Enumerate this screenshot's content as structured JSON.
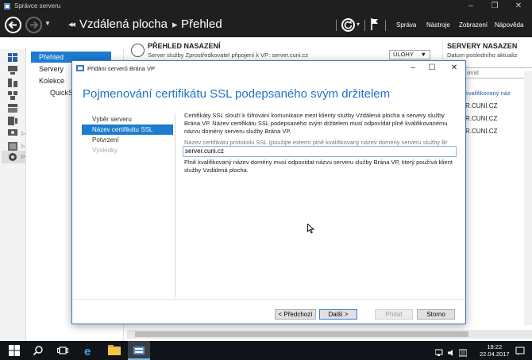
{
  "window": {
    "title": "Správce serveru"
  },
  "header": {
    "breadcrumb_parent": "Vzdálená plocha",
    "breadcrumb_current": "Přehled",
    "menu": [
      "Správa",
      "Nástroje",
      "Zobrazení",
      "Nápověda"
    ]
  },
  "nav": {
    "items": [
      "Přehled",
      "Servery",
      "Kolekce",
      "QuickSe"
    ]
  },
  "background": {
    "deploy_title": "PŘEHLED NASAZENÍ",
    "deploy_sub": "Server služby Zprostředkovatel připojení k VP: server.cuni.cz",
    "tasks_label": "ÚLOHY",
    "servers_title": "SERVERY NASAZEN",
    "servers_sub": "Datum posledního aktualiz",
    "filter_placeholder": "avat",
    "col_header": "kvalifikovaný náz",
    "rows": [
      "R.CUNI.CZ",
      "R.CUNI.CZ",
      "R.CUNI.CZ"
    ]
  },
  "dialog": {
    "title": "Přidání serverů Brána VP",
    "heading": "Pojmenování certifikátu SSL podepsaného svým držitelem",
    "steps": [
      {
        "label": "Výběr serveru",
        "state": "normal"
      },
      {
        "label": "Název certifikátu SSL",
        "state": "selected"
      },
      {
        "label": "Potvrzení",
        "state": "normal"
      },
      {
        "label": "Výsledky",
        "state": "disabled"
      }
    ],
    "description": "Certifikáty SSL slouží k šifrování komunikace mezi klienty služby Vzdálená plocha a servery služby Brána VP. Název certifikátu SSL podepsaného svým držitelem musí odpovídat plně kvalifikovanému názvu domény serveru služby Brána VP.",
    "field_label": "Název certifikátu protokolu SSL (použijte externí plně kvalifikovaný název domény serveru služby Br",
    "field_value": "server.cuni.cz",
    "note": "Plně kvalifikovaný název domény musí odpovídat názvu serveru služby Brána VP, který používá klient služby Vzdálená plocha.",
    "buttons": {
      "prev": "< Předchozí",
      "next": "Další >",
      "add": "Přidat",
      "cancel": "Storno"
    }
  },
  "taskbar": {
    "time": "18:22",
    "date": "22.04.2017"
  },
  "colors": {
    "accent": "#1e7bd0",
    "header_bg": "#1f1f1f",
    "heading": "#1e73c8"
  }
}
